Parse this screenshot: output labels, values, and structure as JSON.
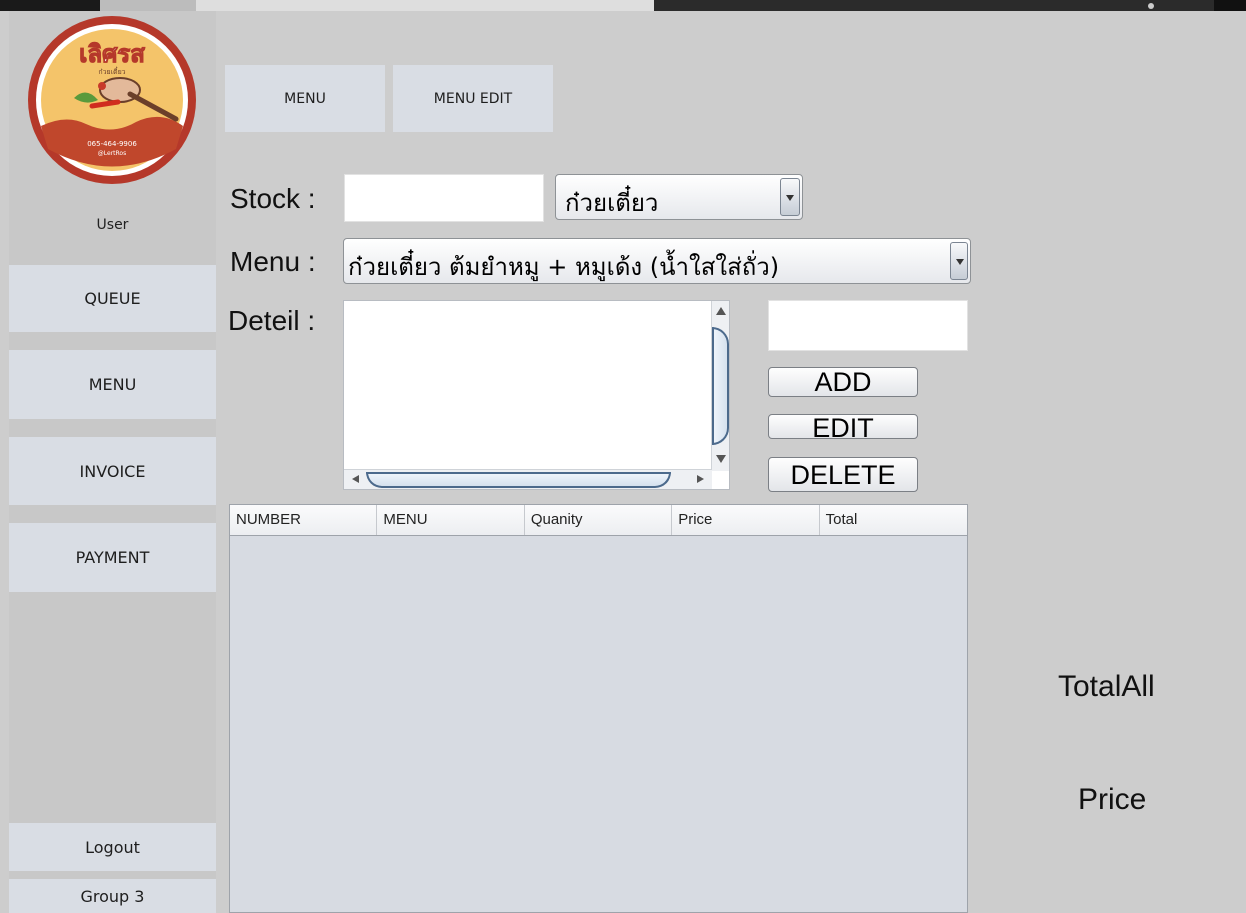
{
  "logo": {
    "brand_text": "เลิศรส",
    "tagline": "ก๋วยเตี๋ยว",
    "phone": "065-464-9906",
    "line_id": "@LertRos"
  },
  "sidebar": {
    "user_label": "User",
    "items": [
      {
        "label": "QUEUE"
      },
      {
        "label": "MENU"
      },
      {
        "label": "INVOICE"
      },
      {
        "label": "PAYMENT"
      }
    ],
    "logout_label": "Logout",
    "group_label": "Group 3"
  },
  "top_tabs": [
    {
      "label": "MENU"
    },
    {
      "label": "MENU EDIT"
    }
  ],
  "form": {
    "stock_label": "Stock :",
    "stock_value": "",
    "category_selected": "ก๋วยเตี๋ยว",
    "menu_label": "Menu :",
    "menu_selected": "ก๋วยเตี๋ยว ต้มยำหมู + หมูเด้ง (น้ำใสใส่ถั่ว)",
    "detail_label": "Deteil :",
    "detail_value": "",
    "price_value": ""
  },
  "actions": {
    "add_label": "ADD",
    "edit_label": "EDIT",
    "delete_label": "DELETE"
  },
  "table": {
    "columns": [
      "NUMBER",
      "MENU",
      "Quanity",
      "Price",
      "Total"
    ],
    "rows": []
  },
  "summary": {
    "total_all_label": "TotalAll",
    "price_label": "Price"
  },
  "colors": {
    "background": "#cdcdcd",
    "button": "#d9dde4",
    "table_body": "#d7dbe2",
    "logo_ring": "#b5382a",
    "logo_fill": "#f4c46a"
  }
}
